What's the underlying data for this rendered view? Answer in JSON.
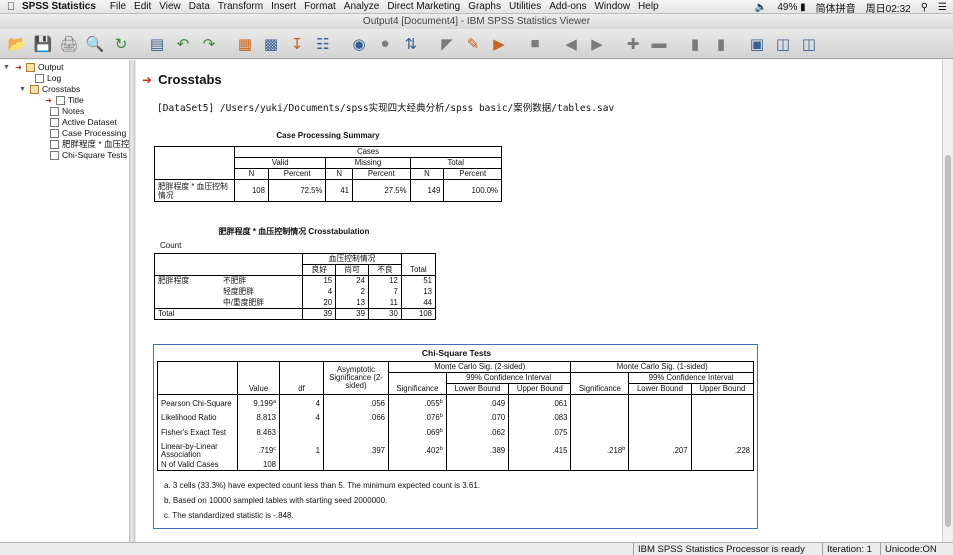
{
  "menubar": {
    "app_name": "SPSS Statistics",
    "items": [
      "File",
      "Edit",
      "View",
      "Data",
      "Transform",
      "Insert",
      "Format",
      "Analyze",
      "Direct Marketing",
      "Graphs",
      "Utilities",
      "Add-ons",
      "Window",
      "Help"
    ],
    "battery": "49%",
    "input_method": "简体拼音",
    "clock": "周日02:32"
  },
  "window": {
    "title": "Output4 [Document4] - IBM SPSS Statistics Viewer"
  },
  "outline": {
    "root": "Output",
    "log": "Log",
    "crosstabs": "Crosstabs",
    "children": [
      "Title",
      "Notes",
      "Active Dataset",
      "Case Processing",
      "肥胖程度 * 血压控",
      "Chi-Square Tests"
    ]
  },
  "content": {
    "heading": "Crosstabs",
    "dataset_line": "[DataSet5] /Users/yuki/Documents/spss实现四大经典分析/spss basic/案例数据/tables.sav",
    "case_processing": {
      "title": "Case Processing Summary",
      "cases_header": "Cases",
      "groups": [
        "Valid",
        "Missing",
        "Total"
      ],
      "sub": [
        "N",
        "Percent"
      ],
      "row_label": "肥胖程度 * 血压控制情况",
      "values": [
        "108",
        "72.5%",
        "41",
        "27.5%",
        "149",
        "100.0%"
      ]
    },
    "crosstab": {
      "title": "肥胖程度 * 血压控制情况 Crosstabulation",
      "count_label": "Count",
      "col_group": "血压控制情况",
      "cols": [
        "良好",
        "尚可",
        "不良"
      ],
      "total_label": "Total",
      "row_var": "肥胖程度",
      "rows": [
        {
          "label": "不肥胖",
          "values": [
            "15",
            "24",
            "12",
            "51"
          ]
        },
        {
          "label": "轻度肥胖",
          "values": [
            "4",
            "2",
            "7",
            "13"
          ]
        },
        {
          "label": "中/重度肥胖",
          "values": [
            "20",
            "13",
            "11",
            "44"
          ]
        }
      ],
      "total_row": {
        "label": "Total",
        "values": [
          "39",
          "39",
          "30",
          "108"
        ]
      }
    },
    "chi_square": {
      "title": "Chi-Square Tests",
      "h_value": "Value",
      "h_df": "df",
      "h_asym": "Asymptotic Significance (2-sided)",
      "h_mc2": "Monte Carlo Sig. (2-sided)",
      "h_mc1": "Monte Carlo Sig. (1-sided)",
      "h_ci": "99% Confidence Interval",
      "h_sig": "Significance",
      "h_lower": "Lower Bound",
      "h_upper": "Upper Bound",
      "rows": [
        {
          "label": "Pearson Chi-Square",
          "value": "9.199",
          "value_sup": "a",
          "df": "4",
          "asym": ".056",
          "sig2": ".055",
          "sig2_sup": "b",
          "lo2": ".049",
          "up2": ".061",
          "sig1": "",
          "sig1_sup": "",
          "lo1": "",
          "up1": ""
        },
        {
          "label": "Likelihood Ratio",
          "value": "8.813",
          "value_sup": "",
          "df": "4",
          "asym": ".066",
          "sig2": ".076",
          "sig2_sup": "b",
          "lo2": ".070",
          "up2": ".083",
          "sig1": "",
          "sig1_sup": "",
          "lo1": "",
          "up1": ""
        },
        {
          "label": "Fisher's Exact Test",
          "value": "8.463",
          "value_sup": "",
          "df": "",
          "asym": "",
          "sig2": ".069",
          "sig2_sup": "b",
          "lo2": ".062",
          "up2": ".075",
          "sig1": "",
          "sig1_sup": "",
          "lo1": "",
          "up1": ""
        },
        {
          "label": "Linear-by-Linear Association",
          "value": ".719",
          "value_sup": "c",
          "df": "1",
          "asym": ".397",
          "sig2": ".402",
          "sig2_sup": "b",
          "lo2": ".389",
          "up2": ".415",
          "sig1": ".218",
          "sig1_sup": "b",
          "lo1": ".207",
          "up1": ".228"
        },
        {
          "label": "N of Valid Cases",
          "value": "108",
          "value_sup": "",
          "df": "",
          "asym": "",
          "sig2": "",
          "sig2_sup": "",
          "lo2": "",
          "up2": "",
          "sig1": "",
          "sig1_sup": "",
          "lo1": "",
          "up1": ""
        }
      ],
      "footnotes": [
        "a. 3 cells (33.3%) have expected count less than 5. The minimum expected count is 3.61.",
        "b. Based on 10000 sampled tables with starting seed 2000000.",
        "c. The standardized statistic is -.848."
      ]
    }
  },
  "status": {
    "processor": "IBM SPSS Statistics Processor is ready",
    "iteration": "Iteration: 1",
    "unicode": "Unicode:ON"
  }
}
